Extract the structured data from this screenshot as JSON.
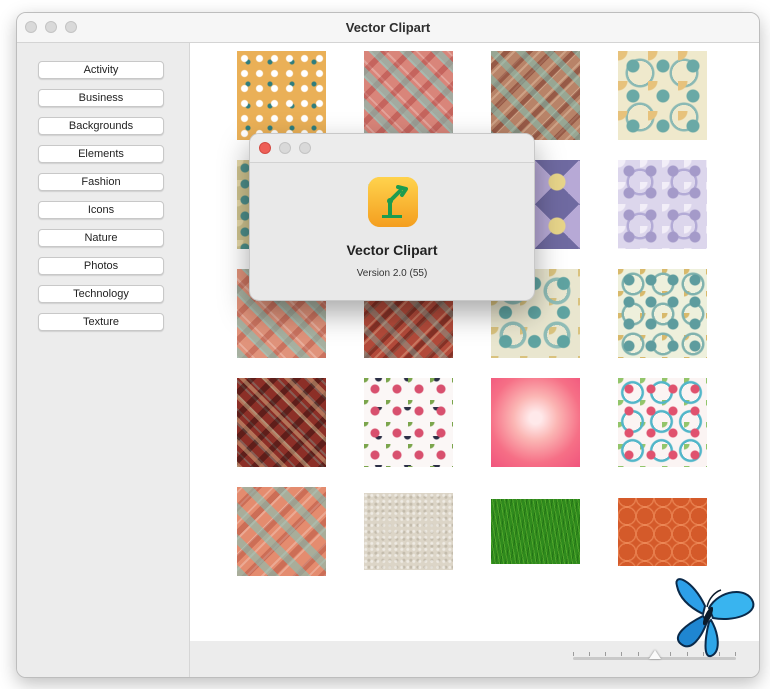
{
  "window": {
    "title": "Vector Clipart"
  },
  "sidebar": {
    "categories": [
      "Activity",
      "Business",
      "Backgrounds",
      "Elements",
      "Fashion",
      "Icons",
      "Nature",
      "Photos",
      "Technology",
      "Texture"
    ]
  },
  "grid": {
    "tiles": [
      {
        "name": "ornament-orange-tile"
      },
      {
        "name": "plaid-pink-teal-tile"
      },
      {
        "name": "plaid-brown-teal-tile"
      },
      {
        "name": "damask-cream-teal-tile"
      },
      {
        "name": "ornament-teal-tile"
      },
      {
        "name": "plaid-tile"
      },
      {
        "name": "kaleidoscope-purple-tile"
      },
      {
        "name": "damask-lilac-tile"
      },
      {
        "name": "plaid-peach-teal-tile"
      },
      {
        "name": "plaid-red-tile"
      },
      {
        "name": "kaleidoscope-teal-cream-tile"
      },
      {
        "name": "damask-teal-cream-tile"
      },
      {
        "name": "plaid-dark-red-tile"
      },
      {
        "name": "floral-white-tile"
      },
      {
        "name": "gradient-pink-tile"
      },
      {
        "name": "floral-mandala-tile"
      },
      {
        "name": "plaid-coral-tile"
      },
      {
        "name": "texture-beige-tile"
      },
      {
        "name": "grass-green-tile"
      },
      {
        "name": "moroccan-orange-tile"
      }
    ]
  },
  "slider": {
    "zoom_level": 0.5
  },
  "about": {
    "app_name": "Vector Clipart",
    "version": "Version 2.0 (55)"
  }
}
